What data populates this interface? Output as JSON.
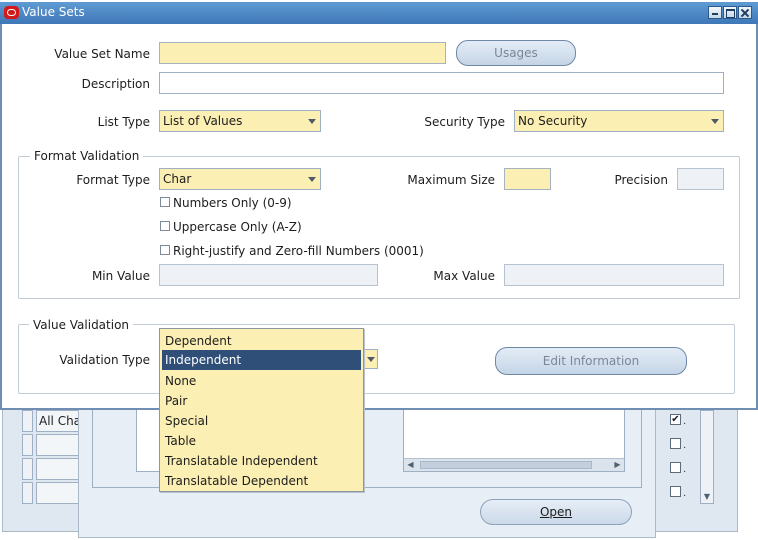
{
  "window": {
    "title": "Value Sets"
  },
  "form": {
    "value_set_name_label": "Value Set Name",
    "value_set_name_value": "",
    "usages_button": "Usages",
    "description_label": "Description",
    "description_value": "",
    "list_type_label": "List Type",
    "list_type_value": "List of Values",
    "security_type_label": "Security Type",
    "security_type_value": "No Security"
  },
  "format_validation": {
    "title": "Format Validation",
    "format_type_label": "Format Type",
    "format_type_value": "Char",
    "maximum_size_label": "Maximum Size",
    "maximum_size_value": "",
    "precision_label": "Precision",
    "precision_value": "",
    "numbers_only_label": "Numbers Only (0-9)",
    "numbers_only_checked": false,
    "uppercase_only_label": "Uppercase Only (A-Z)",
    "uppercase_only_checked": false,
    "right_justify_label": "Right-justify and Zero-fill Numbers (0001)",
    "right_justify_checked": false,
    "min_value_label": "Min Value",
    "min_value_value": "",
    "max_value_label": "Max Value",
    "max_value_value": ""
  },
  "value_validation": {
    "title": "Value Validation",
    "validation_type_label": "Validation Type",
    "edit_information_button": "Edit Information",
    "options": [
      "Dependent",
      "Independent",
      "None",
      "Pair",
      "Special",
      "Table",
      "Translatable Independent",
      "Translatable Dependent"
    ],
    "selected_option": "Independent"
  },
  "background": {
    "cell_text": "All Cha",
    "open_button": "Open",
    "checkbox_states": [
      true,
      false,
      false,
      false
    ]
  },
  "colors": {
    "titlebar": "#4a86c5",
    "required_field": "#fcefb4",
    "selected_item": "#2f4f79"
  }
}
